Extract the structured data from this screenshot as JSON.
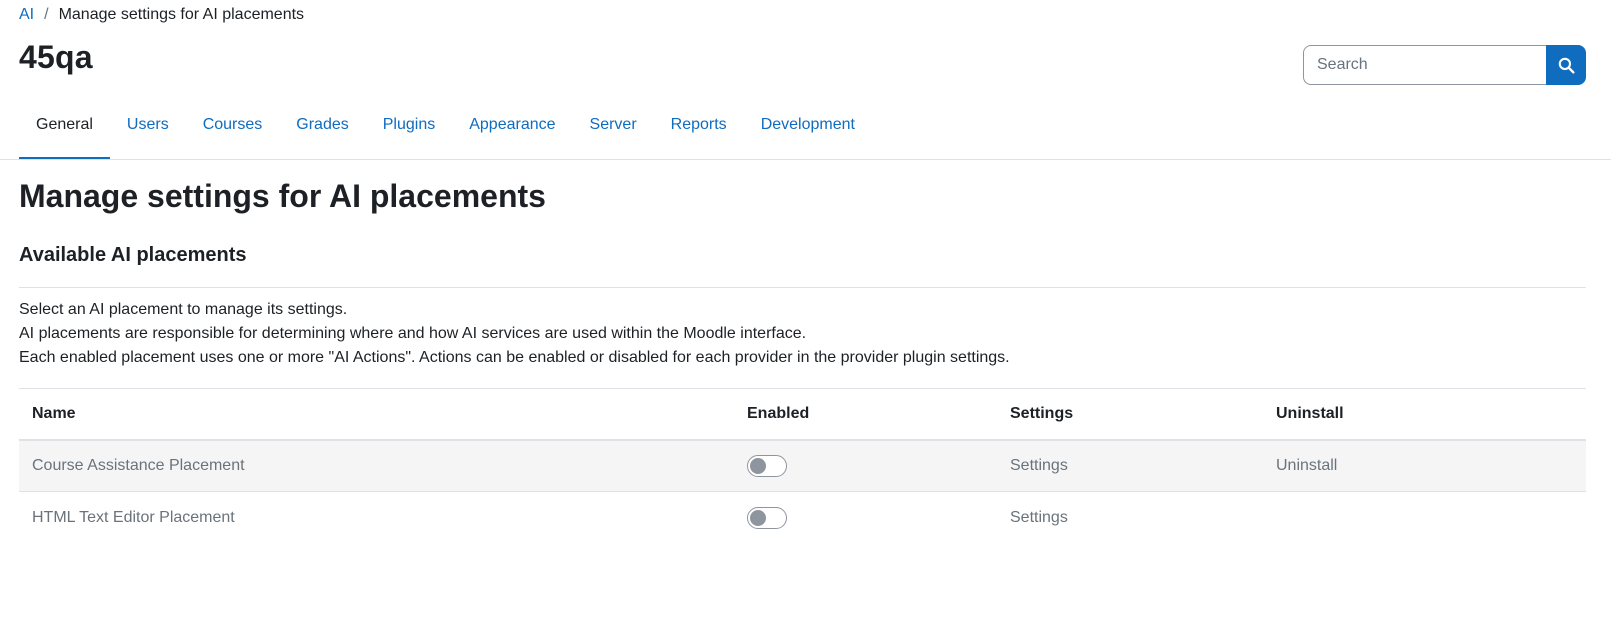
{
  "breadcrumb": {
    "root": "AI",
    "separator": "/",
    "current": "Manage settings for AI placements"
  },
  "site_title": "45qa",
  "search": {
    "placeholder": "Search",
    "value": ""
  },
  "tabs": [
    {
      "label": "General",
      "active": true
    },
    {
      "label": "Users"
    },
    {
      "label": "Courses"
    },
    {
      "label": "Grades"
    },
    {
      "label": "Plugins"
    },
    {
      "label": "Appearance"
    },
    {
      "label": "Server"
    },
    {
      "label": "Reports"
    },
    {
      "label": "Development"
    }
  ],
  "page": {
    "heading": "Manage settings for AI placements",
    "section_heading": "Available AI placements",
    "description": [
      "Select an AI placement to manage its settings.",
      "AI placements are responsible for determining where and how AI services are used within the Moodle interface.",
      "Each enabled placement uses one or more \"AI Actions\". Actions can be enabled or disabled for each provider in the provider plugin settings."
    ]
  },
  "table": {
    "headers": {
      "name": "Name",
      "enabled": "Enabled",
      "settings": "Settings",
      "uninstall": "Uninstall"
    },
    "rows": [
      {
        "name": "Course Assistance Placement",
        "enabled": false,
        "settings": "Settings",
        "uninstall": "Uninstall"
      },
      {
        "name": "HTML Text Editor Placement",
        "enabled": false,
        "settings": "Settings",
        "uninstall": ""
      }
    ]
  },
  "colors": {
    "link": "#0f6cbf",
    "text": "#1d2125",
    "muted": "#6a737b",
    "border": "#dee2e6"
  },
  "icons": {
    "search_button": "search-icon"
  }
}
